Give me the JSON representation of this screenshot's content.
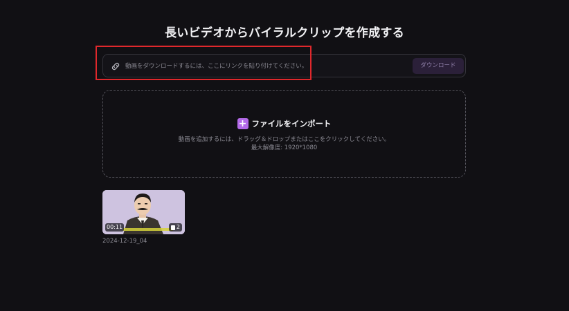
{
  "page": {
    "title": "長いビデオからバイラルクリップを作成する"
  },
  "url_bar": {
    "placeholder": "動画をダウンロードするには、ここにリンクを貼り付けてください。",
    "link_icon": "link-icon",
    "download_label": "ダウンロード"
  },
  "import": {
    "plus_icon": "plus-icon",
    "label": "ファイルをインポート",
    "hint": "動画を追加するには、ドラッグ＆ドロップまたはここをクリックしてください。",
    "resolution": "最大解像度: 1920*1080"
  },
  "videos": [
    {
      "duration": "00:11",
      "clip_count": "2",
      "name": "2024-12-19_04"
    }
  ],
  "colors": {
    "background": "#111014",
    "accent": "#b36ae8",
    "highlight": "#e0282c",
    "button_bg": "#2b2039"
  }
}
